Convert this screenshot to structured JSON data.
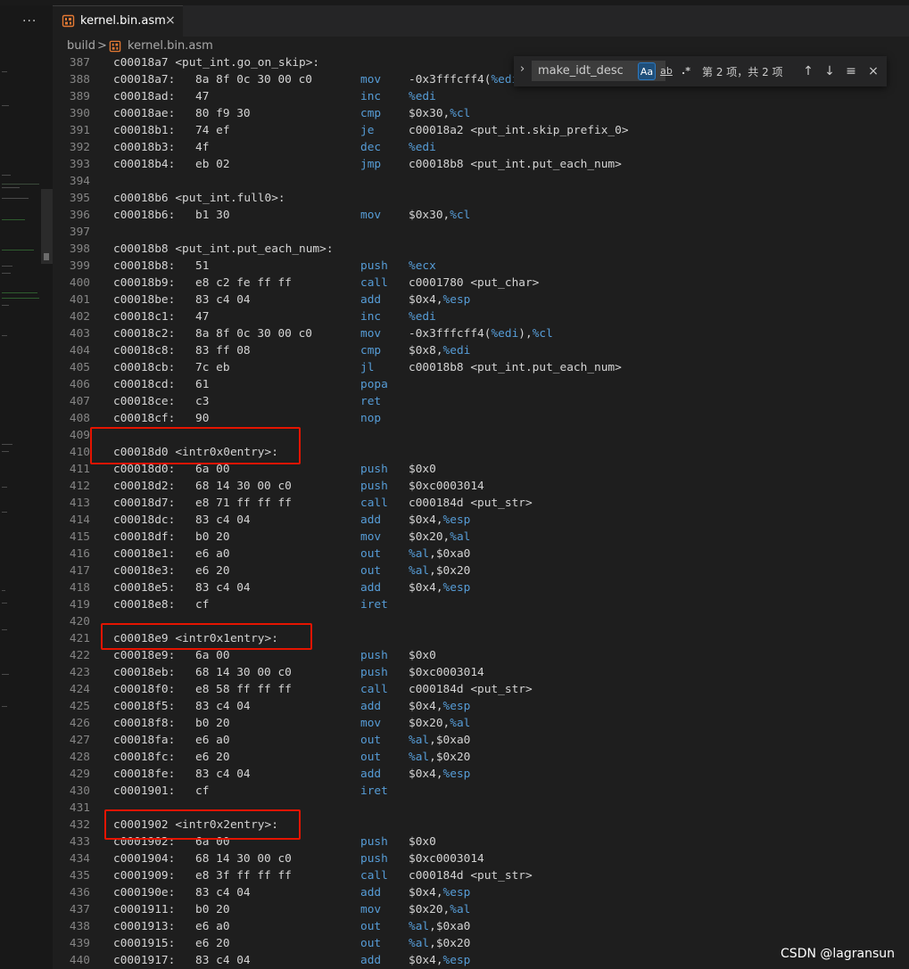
{
  "left_panel": {
    "more_label": "···"
  },
  "tab": {
    "title": "kernel.bin.asm",
    "close": "×"
  },
  "breadcrumb": {
    "folder": "build",
    "separator": ">",
    "file": "kernel.bin.asm"
  },
  "find_widget": {
    "query": "make_idt_desc",
    "match_case_label": "Aa",
    "whole_word_label": "ab",
    "regex_label": ".*",
    "match_count": "第 2 项，共 2 项",
    "prev": "↑",
    "next": "↓",
    "selection": "≡",
    "close": "×",
    "toggle": "›"
  },
  "watermark": "CSDN @lagransun",
  "colors": {
    "background": "#1e1e1e",
    "keyword": "#569cd6",
    "line_number": "#858585",
    "highlight_box": "#e51400"
  },
  "lines": [
    {
      "ln": "387",
      "label": "c00018a7 <put_int.go_on_skip>:"
    },
    {
      "ln": "388",
      "addr": "c00018a7:",
      "hex": "8a 8f 0c 30 00 c0",
      "mnem": "mov",
      "ops": [
        {
          "t": "-0x3fffcff4(",
          "c": "p"
        },
        {
          "t": "%edi",
          "c": "r"
        }
      ]
    },
    {
      "ln": "389",
      "addr": "c00018ad:",
      "hex": "47",
      "mnem": "inc",
      "ops": [
        {
          "t": "%edi",
          "c": "r"
        }
      ]
    },
    {
      "ln": "390",
      "addr": "c00018ae:",
      "hex": "80 f9 30",
      "mnem": "cmp",
      "ops": [
        {
          "t": "$0x30,",
          "c": "p"
        },
        {
          "t": "%cl",
          "c": "r"
        }
      ]
    },
    {
      "ln": "391",
      "addr": "c00018b1:",
      "hex": "74 ef",
      "mnem": "je",
      "ops": [
        {
          "t": "c00018a2 <put_int.skip_prefix_0>",
          "c": "p"
        }
      ]
    },
    {
      "ln": "392",
      "addr": "c00018b3:",
      "hex": "4f",
      "mnem": "dec",
      "ops": [
        {
          "t": "%edi",
          "c": "r"
        }
      ]
    },
    {
      "ln": "393",
      "addr": "c00018b4:",
      "hex": "eb 02",
      "mnem": "jmp",
      "ops": [
        {
          "t": "c00018b8 <put_int.put_each_num>",
          "c": "p"
        }
      ]
    },
    {
      "ln": "394"
    },
    {
      "ln": "395",
      "label": "c00018b6 <put_int.full0>:"
    },
    {
      "ln": "396",
      "addr": "c00018b6:",
      "hex": "b1 30",
      "mnem": "mov",
      "ops": [
        {
          "t": "$0x30,",
          "c": "p"
        },
        {
          "t": "%cl",
          "c": "r"
        }
      ]
    },
    {
      "ln": "397"
    },
    {
      "ln": "398",
      "label": "c00018b8 <put_int.put_each_num>:"
    },
    {
      "ln": "399",
      "addr": "c00018b8:",
      "hex": "51",
      "mnem": "push",
      "ops": [
        {
          "t": "%ecx",
          "c": "r"
        }
      ]
    },
    {
      "ln": "400",
      "addr": "c00018b9:",
      "hex": "e8 c2 fe ff ff",
      "mnem": "call",
      "ops": [
        {
          "t": "c0001780 <put_char>",
          "c": "p"
        }
      ]
    },
    {
      "ln": "401",
      "addr": "c00018be:",
      "hex": "83 c4 04",
      "mnem": "add",
      "ops": [
        {
          "t": "$0x4,",
          "c": "p"
        },
        {
          "t": "%esp",
          "c": "r"
        }
      ]
    },
    {
      "ln": "402",
      "addr": "c00018c1:",
      "hex": "47",
      "mnem": "inc",
      "ops": [
        {
          "t": "%edi",
          "c": "r"
        }
      ]
    },
    {
      "ln": "403",
      "addr": "c00018c2:",
      "hex": "8a 8f 0c 30 00 c0",
      "mnem": "mov",
      "ops": [
        {
          "t": "-0x3fffcff4(",
          "c": "p"
        },
        {
          "t": "%edi",
          "c": "r"
        },
        {
          "t": "),",
          "c": "p"
        },
        {
          "t": "%cl",
          "c": "r"
        }
      ]
    },
    {
      "ln": "404",
      "addr": "c00018c8:",
      "hex": "83 ff 08",
      "mnem": "cmp",
      "ops": [
        {
          "t": "$0x8,",
          "c": "p"
        },
        {
          "t": "%edi",
          "c": "r"
        }
      ]
    },
    {
      "ln": "405",
      "addr": "c00018cb:",
      "hex": "7c eb",
      "mnem": "jl",
      "ops": [
        {
          "t": "c00018b8 <put_int.put_each_num>",
          "c": "p"
        }
      ]
    },
    {
      "ln": "406",
      "addr": "c00018cd:",
      "hex": "61",
      "mnem": "popa"
    },
    {
      "ln": "407",
      "addr": "c00018ce:",
      "hex": "c3",
      "mnem": "ret"
    },
    {
      "ln": "408",
      "addr": "c00018cf:",
      "hex": "90",
      "mnem": "nop"
    },
    {
      "ln": "409"
    },
    {
      "ln": "410",
      "label": "c00018d0 <intr0x0entry>:"
    },
    {
      "ln": "411",
      "addr": "c00018d0:",
      "hex": "6a 00",
      "mnem": "push",
      "ops": [
        {
          "t": "$0x0",
          "c": "p"
        }
      ]
    },
    {
      "ln": "412",
      "addr": "c00018d2:",
      "hex": "68 14 30 00 c0",
      "mnem": "push",
      "ops": [
        {
          "t": "$0xc0003014",
          "c": "p"
        }
      ]
    },
    {
      "ln": "413",
      "addr": "c00018d7:",
      "hex": "e8 71 ff ff ff",
      "mnem": "call",
      "ops": [
        {
          "t": "c000184d <put_str>",
          "c": "p"
        }
      ]
    },
    {
      "ln": "414",
      "addr": "c00018dc:",
      "hex": "83 c4 04",
      "mnem": "add",
      "ops": [
        {
          "t": "$0x4,",
          "c": "p"
        },
        {
          "t": "%esp",
          "c": "r"
        }
      ]
    },
    {
      "ln": "415",
      "addr": "c00018df:",
      "hex": "b0 20",
      "mnem": "mov",
      "ops": [
        {
          "t": "$0x20,",
          "c": "p"
        },
        {
          "t": "%al",
          "c": "r"
        }
      ]
    },
    {
      "ln": "416",
      "addr": "c00018e1:",
      "hex": "e6 a0",
      "mnem": "out",
      "ops": [
        {
          "t": "%al",
          "c": "r"
        },
        {
          "t": ",$0xa0",
          "c": "p"
        }
      ]
    },
    {
      "ln": "417",
      "addr": "c00018e3:",
      "hex": "e6 20",
      "mnem": "out",
      "ops": [
        {
          "t": "%al",
          "c": "r"
        },
        {
          "t": ",$0x20",
          "c": "p"
        }
      ]
    },
    {
      "ln": "418",
      "addr": "c00018e5:",
      "hex": "83 c4 04",
      "mnem": "add",
      "ops": [
        {
          "t": "$0x4,",
          "c": "p"
        },
        {
          "t": "%esp",
          "c": "r"
        }
      ]
    },
    {
      "ln": "419",
      "addr": "c00018e8:",
      "hex": "cf",
      "mnem": "iret"
    },
    {
      "ln": "420"
    },
    {
      "ln": "421",
      "label": "c00018e9 <intr0x1entry>:"
    },
    {
      "ln": "422",
      "addr": "c00018e9:",
      "hex": "6a 00",
      "mnem": "push",
      "ops": [
        {
          "t": "$0x0",
          "c": "p"
        }
      ]
    },
    {
      "ln": "423",
      "addr": "c00018eb:",
      "hex": "68 14 30 00 c0",
      "mnem": "push",
      "ops": [
        {
          "t": "$0xc0003014",
          "c": "p"
        }
      ]
    },
    {
      "ln": "424",
      "addr": "c00018f0:",
      "hex": "e8 58 ff ff ff",
      "mnem": "call",
      "ops": [
        {
          "t": "c000184d <put_str>",
          "c": "p"
        }
      ]
    },
    {
      "ln": "425",
      "addr": "c00018f5:",
      "hex": "83 c4 04",
      "mnem": "add",
      "ops": [
        {
          "t": "$0x4,",
          "c": "p"
        },
        {
          "t": "%esp",
          "c": "r"
        }
      ]
    },
    {
      "ln": "426",
      "addr": "c00018f8:",
      "hex": "b0 20",
      "mnem": "mov",
      "ops": [
        {
          "t": "$0x20,",
          "c": "p"
        },
        {
          "t": "%al",
          "c": "r"
        }
      ]
    },
    {
      "ln": "427",
      "addr": "c00018fa:",
      "hex": "e6 a0",
      "mnem": "out",
      "ops": [
        {
          "t": "%al",
          "c": "r"
        },
        {
          "t": ",$0xa0",
          "c": "p"
        }
      ]
    },
    {
      "ln": "428",
      "addr": "c00018fc:",
      "hex": "e6 20",
      "mnem": "out",
      "ops": [
        {
          "t": "%al",
          "c": "r"
        },
        {
          "t": ",$0x20",
          "c": "p"
        }
      ]
    },
    {
      "ln": "429",
      "addr": "c00018fe:",
      "hex": "83 c4 04",
      "mnem": "add",
      "ops": [
        {
          "t": "$0x4,",
          "c": "p"
        },
        {
          "t": "%esp",
          "c": "r"
        }
      ]
    },
    {
      "ln": "430",
      "addr": "c0001901:",
      "hex": "cf",
      "mnem": "iret"
    },
    {
      "ln": "431"
    },
    {
      "ln": "432",
      "label": "c0001902 <intr0x2entry>:"
    },
    {
      "ln": "433",
      "addr": "c0001902:",
      "hex": "6a 00",
      "mnem": "push",
      "ops": [
        {
          "t": "$0x0",
          "c": "p"
        }
      ]
    },
    {
      "ln": "434",
      "addr": "c0001904:",
      "hex": "68 14 30 00 c0",
      "mnem": "push",
      "ops": [
        {
          "t": "$0xc0003014",
          "c": "p"
        }
      ]
    },
    {
      "ln": "435",
      "addr": "c0001909:",
      "hex": "e8 3f ff ff ff",
      "mnem": "call",
      "ops": [
        {
          "t": "c000184d <put_str>",
          "c": "p"
        }
      ]
    },
    {
      "ln": "436",
      "addr": "c000190e:",
      "hex": "83 c4 04",
      "mnem": "add",
      "ops": [
        {
          "t": "$0x4,",
          "c": "p"
        },
        {
          "t": "%esp",
          "c": "r"
        }
      ]
    },
    {
      "ln": "437",
      "addr": "c0001911:",
      "hex": "b0 20",
      "mnem": "mov",
      "ops": [
        {
          "t": "$0x20,",
          "c": "p"
        },
        {
          "t": "%al",
          "c": "r"
        }
      ]
    },
    {
      "ln": "438",
      "addr": "c0001913:",
      "hex": "e6 a0",
      "mnem": "out",
      "ops": [
        {
          "t": "%al",
          "c": "r"
        },
        {
          "t": ",$0xa0",
          "c": "p"
        }
      ]
    },
    {
      "ln": "439",
      "addr": "c0001915:",
      "hex": "e6 20",
      "mnem": "out",
      "ops": [
        {
          "t": "%al",
          "c": "r"
        },
        {
          "t": ",$0x20",
          "c": "p"
        }
      ]
    },
    {
      "ln": "440",
      "addr": "c0001917:",
      "hex": "83 c4 04",
      "mnem": "add",
      "ops": [
        {
          "t": "$0x4,",
          "c": "p"
        },
        {
          "t": "%esp",
          "c": "r"
        }
      ]
    }
  ],
  "highlight_boxes": [
    {
      "line_ln": "410",
      "label": "c00018d0 <intr0x0entry>:"
    },
    {
      "line_ln": "421",
      "label": "c00018e9 <intr0x1entry>:"
    },
    {
      "line_ln": "432",
      "label": "c0001902 <intr0x2entry>:"
    }
  ]
}
